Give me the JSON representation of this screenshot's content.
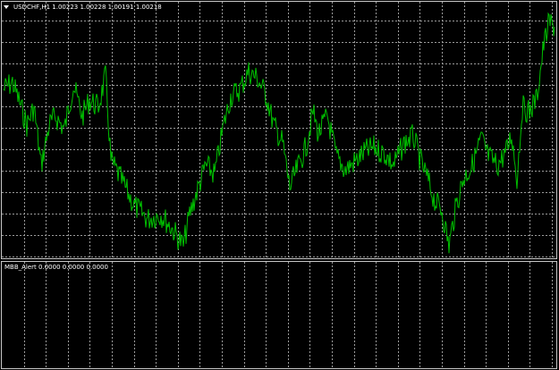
{
  "main_panel": {
    "title": "USDCHF,H1  1.00223 1.00228 1.00191 1.00218",
    "line_color": "#00c000",
    "grid_color": "#9a9a9a",
    "background": "#000000",
    "frame_color": "#c8c8c8",
    "series_seed": 7
  },
  "indicator_panel": {
    "title": "MBB_Alert 0.0000 0.0000 0.0000"
  }
}
